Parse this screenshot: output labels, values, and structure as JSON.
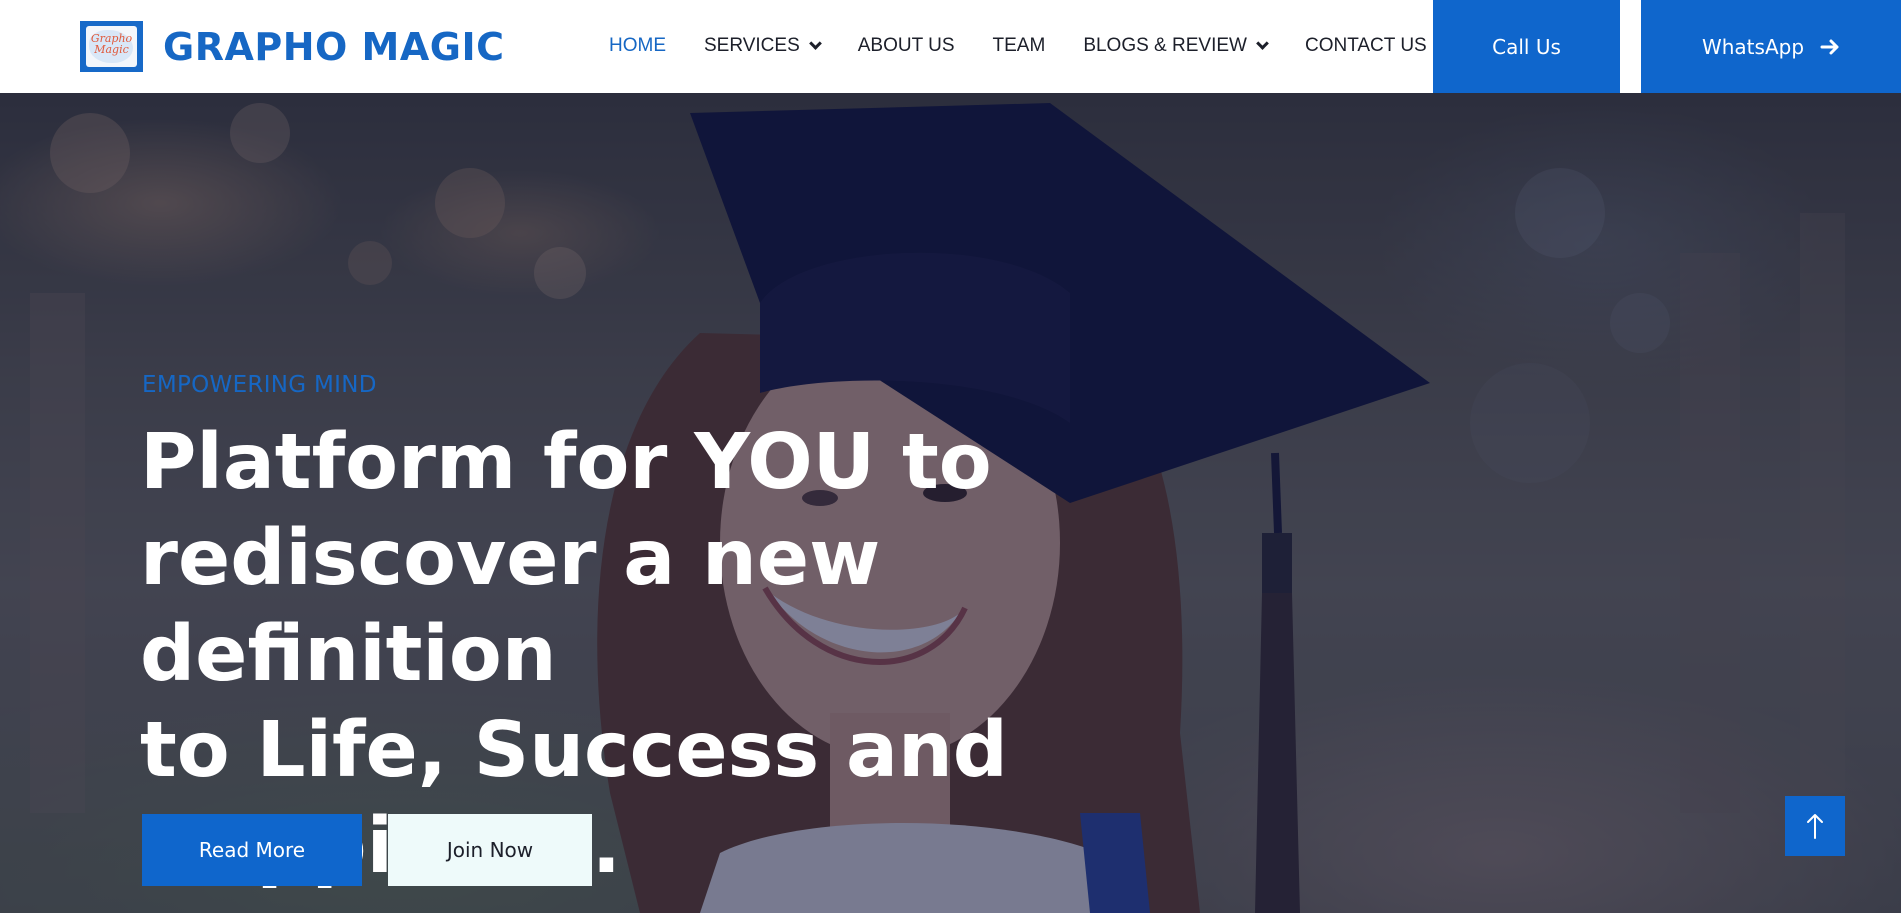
{
  "brand": {
    "name": "GRAPHO MAGIC",
    "logo_text_line1": "Grapho",
    "logo_text_line2": "Magic",
    "logo_icon": "grapho-magic-logo-icon"
  },
  "nav": {
    "items": [
      {
        "label": "HOME",
        "active": true,
        "has_dropdown": false
      },
      {
        "label": "SERVICES",
        "active": false,
        "has_dropdown": true
      },
      {
        "label": "ABOUT US",
        "active": false,
        "has_dropdown": false
      },
      {
        "label": "TEAM",
        "active": false,
        "has_dropdown": false
      },
      {
        "label": "BLOGS & REVIEW",
        "active": false,
        "has_dropdown": true
      },
      {
        "label": "CONTACT US",
        "active": false,
        "has_dropdown": false
      }
    ],
    "dropdown_icon": "chevron-down-icon"
  },
  "header_actions": {
    "call_label": "Call Us",
    "whatsapp_label": "WhatsApp",
    "whatsapp_icon": "arrow-right-icon"
  },
  "hero": {
    "eyebrow": "EMPOWERING MIND",
    "headline_lines": [
      "Platform for YOU to",
      "rediscover a new definition",
      "to Life, Success and",
      "Happiness."
    ],
    "read_more_label": "Read More",
    "join_now_label": "Join Now",
    "background_image": "graduate-in-cap-photo"
  },
  "scroll_top": {
    "icon": "arrow-up-icon"
  },
  "colors": {
    "accent": "#0f66cc",
    "brand_text": "#1667c4",
    "nav_text": "#1c1f2a",
    "overlay": "#141840",
    "join_bg": "#eefafa"
  }
}
